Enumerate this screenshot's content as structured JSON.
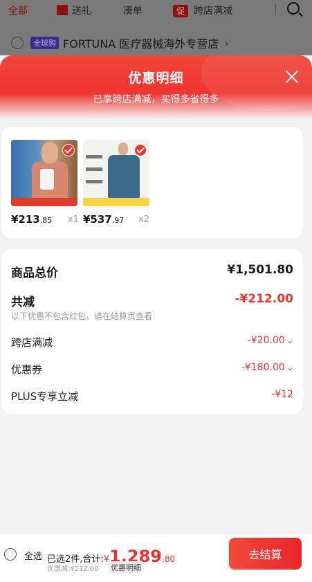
{
  "background": {
    "tabs": [
      "全部",
      "送礼",
      "凑单",
      "跨店满减"
    ],
    "promo_glyph": "促",
    "store_badge": "全球购",
    "store_name": "FORTUNA 医疗器械海外专营店",
    "store_chevron": "›"
  },
  "sheet": {
    "title": "优惠明细",
    "subtitle": "已享跨店满减，买得多省得多",
    "products": [
      {
        "price_int": "¥213",
        "price_dec": ".85",
        "qty": "x1"
      },
      {
        "price_int": "¥537",
        "price_dec": ".97",
        "qty": "x2"
      }
    ],
    "total_label": "商品总价",
    "total_value": "¥1,501.80",
    "save_label": "共减",
    "save_value": "-¥212.00",
    "note": "以下优惠不包含红包，请在结算页查看",
    "items": [
      {
        "label": "跨店满减",
        "value": "-¥20.00",
        "chevron": "⌄"
      },
      {
        "label": "优惠券",
        "value": "-¥180.00",
        "chevron": "⌄"
      },
      {
        "label": "PLUS专享立减",
        "value": "-¥12",
        "chevron": ""
      }
    ]
  },
  "bottom": {
    "select_all": "全选",
    "selected_prefix": "已选2件,合计:",
    "currency": "¥",
    "total_int": "1,289",
    "total_dec": ".80",
    "saved": "优惠减:¥212.00",
    "detail_link": "优惠明细",
    "checkout": "去结算"
  },
  "colors": {
    "accent": "#e8362e",
    "header": "#ef3530"
  }
}
